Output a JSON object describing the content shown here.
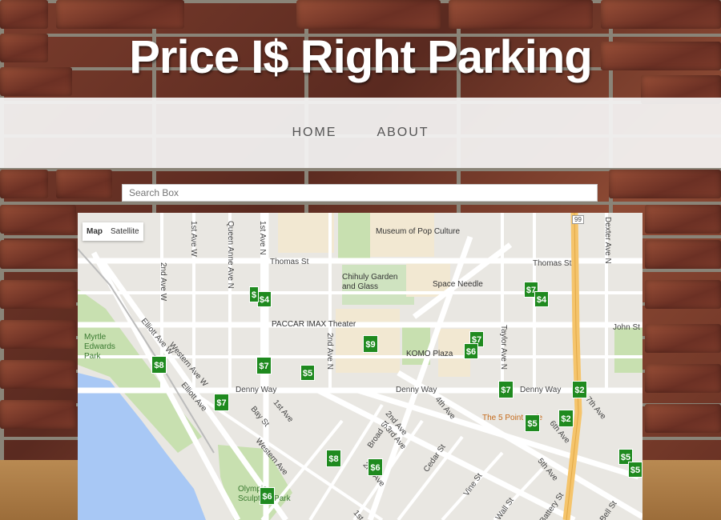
{
  "site": {
    "title": "Price I$ Right Parking"
  },
  "nav": {
    "items": [
      {
        "label": "HOME"
      },
      {
        "label": "ABOUT"
      }
    ]
  },
  "search": {
    "placeholder": "Search Box"
  },
  "map": {
    "type_controls": [
      {
        "label": "Map"
      },
      {
        "label": "Satellite"
      }
    ],
    "poi": {
      "pop_culture": "Museum of Pop Culture",
      "chihuly": "Chihuly Garden and Glass",
      "space_needle": "Space Needle",
      "imax": "PACCAR IMAX Theater",
      "komo": "KOMO Plaza",
      "five_point": "The 5 Point Cafe",
      "myrtle": "Myrtle Edwards Park",
      "olympic": "Olympic Sculpture Park"
    },
    "streets": {
      "thomas_w": "Thomas St",
      "thomas_e": "Thomas St",
      "john": "John St",
      "denny_w": "Denny Way",
      "denny_m": "Denny Way",
      "denny_e": "Denny Way",
      "second_w": "2nd Ave W",
      "first_w": "1st Ave W",
      "queen_anne": "Queen Anne Ave N",
      "first_n": "1st Ave N",
      "second_n": "2nd Ave N",
      "taylor": "Taylor Ave N",
      "dexter": "Dexter Ave N",
      "elliott_w": "Elliott Ave W",
      "western_w": "Western Ave W",
      "elliott": "Elliott Ave",
      "western": "Western Ave",
      "bay": "Bay St",
      "first": "1st Ave",
      "broad": "Broad St",
      "second": "2nd Ave",
      "third": "3rd Ave",
      "fourth": "4th Ave",
      "fifth": "5th Ave",
      "sixth": "6th Ave",
      "seventh": "7th Ave",
      "cedar": "Cedar St",
      "vine": "Vine St",
      "wall": "Wall St",
      "battery": "Battery St",
      "bell": "Bell St",
      "first_s": "1st Ave",
      "second_s": "2nd Ave",
      "hwy": "99"
    },
    "pins": [
      {
        "label": "$8"
      },
      {
        "label": "$7"
      },
      {
        "label": "$7"
      },
      {
        "label": "$5"
      },
      {
        "label": "$4"
      },
      {
        "label": "$9"
      },
      {
        "label": "$7"
      },
      {
        "label": "$4"
      },
      {
        "label": "$7"
      },
      {
        "label": "$6"
      },
      {
        "label": "$7"
      },
      {
        "label": "$2"
      },
      {
        "label": "$5"
      },
      {
        "label": "$2"
      },
      {
        "label": "$8"
      },
      {
        "label": "$6"
      },
      {
        "label": "$6"
      },
      {
        "label": "$5"
      },
      {
        "label": "$5"
      },
      {
        "label": "$"
      }
    ],
    "colors": {
      "pin": "#1f8a1f",
      "water": "#a8c8f5",
      "park": "#c8e0b0",
      "highway": "#f5c46b"
    }
  }
}
